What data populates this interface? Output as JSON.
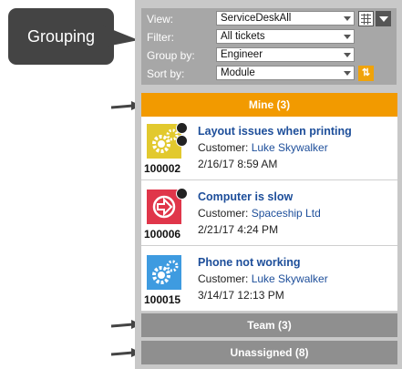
{
  "callout": {
    "label": "Grouping"
  },
  "filters": {
    "view": {
      "label": "View:",
      "value": "ServiceDeskAll"
    },
    "filter": {
      "label": "Filter:",
      "value": "All tickets"
    },
    "group_by": {
      "label": "Group by:",
      "value": "Engineer"
    },
    "sort_by": {
      "label": "Sort by:",
      "value": "Module"
    }
  },
  "groups": {
    "mine": "Mine (3)",
    "team": "Team (3)",
    "unassigned": "Unassigned (8)"
  },
  "tickets": [
    {
      "id": "100002",
      "title": "Layout issues when printing",
      "customer_label": "Customer: ",
      "customer": "Luke Skywalker",
      "date": "2/16/17 8:59 AM",
      "icon": "gears-icon",
      "color": "#e2c92e"
    },
    {
      "id": "100006",
      "title": "Computer is slow",
      "customer_label": "Customer: ",
      "customer": "Spaceship Ltd",
      "date": "2/21/17 4:24 PM",
      "icon": "arrow-circle-icon",
      "color": "#e0364a"
    },
    {
      "id": "100015",
      "title": "Phone not working",
      "customer_label": "Customer: ",
      "customer": "Luke Skywalker",
      "date": "3/14/17 12:13 PM",
      "icon": "gears-icon",
      "color": "#3e9be0"
    }
  ],
  "colors": {
    "accent": "#f29a00",
    "collapsed": "#8f8f8f",
    "link": "#1d4e9a"
  }
}
